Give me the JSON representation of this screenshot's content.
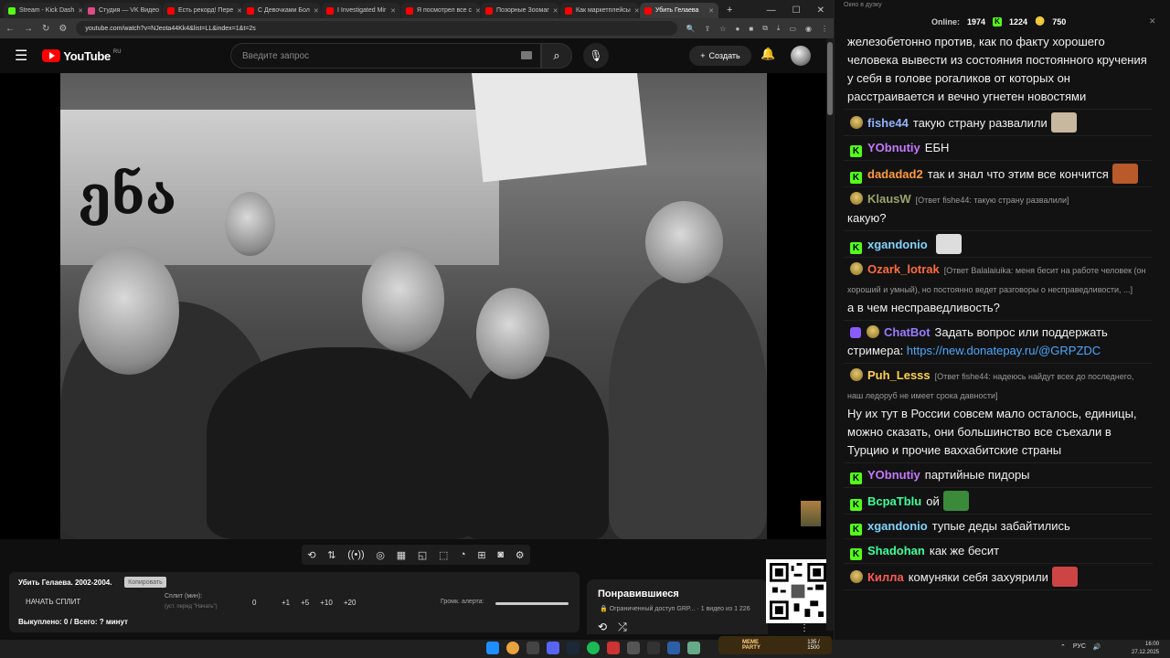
{
  "browser": {
    "tabs": [
      {
        "label": "Stream - Kick Dash",
        "color": "#53fc18",
        "active": false
      },
      {
        "label": "Студия — VK Видео",
        "color": "#e04a8a",
        "active": false
      },
      {
        "label": "Есть рекорд! Пере",
        "color": "#ff0000",
        "active": false
      },
      {
        "label": "С Девочками Бол",
        "color": "#ff0000",
        "active": false
      },
      {
        "label": "I Investigated Mir",
        "color": "#ff0000",
        "active": false
      },
      {
        "label": "Я посмотрел все с",
        "color": "#ff0000",
        "active": false
      },
      {
        "label": "Позорные Зоомаг",
        "color": "#ff0000",
        "active": false
      },
      {
        "label": "Как маркетплейсы",
        "color": "#ff0000",
        "active": false
      },
      {
        "label": "Убить Гелаева",
        "color": "#ff0000",
        "active": true
      }
    ],
    "url": "youtube.com/watch?v=NJeota44Kk4&list=LL&index=1&t=2s",
    "new_tab": "+",
    "window_controls": [
      "—",
      "☐",
      "✕"
    ]
  },
  "youtube": {
    "logo_text": "YouTube",
    "region": "RU",
    "search_placeholder": "Введите запрос",
    "create_label": "Создать"
  },
  "split_panel": {
    "title": "Убить Гелаева. 2002-2004.",
    "copy_label": "Копировать",
    "start_label": "НАЧАТЬ СПЛИТ",
    "split_label": "Сплит (мин):",
    "split_hint": "(уст. перед \"Начать\")",
    "current": "0",
    "increments": [
      "+1",
      "+5",
      "+10",
      "+20"
    ],
    "alert_label": "Громк. алерта:",
    "done_text": "Выкуплено: 0 / Всего: ? минут"
  },
  "liked": {
    "title": "Понравившиеся",
    "subtitle": "Ограниченный доступ GRP...",
    "count": "1 видео из 1 226"
  },
  "chat": {
    "window_title": "Окно в дуэку",
    "online_label": "Online:",
    "online_count": "1974",
    "kick_count": "1224",
    "coin_count": "750",
    "messages": [
      {
        "nick": "",
        "badge": "none",
        "color": "#ffffff",
        "reply": "",
        "text": "железобетонно против, как по факту хорошего человека вывести из состояния постоянного кручения у себя в голове рогаликов от которых он расстраивается и вечно угнетен новостями"
      },
      {
        "nick": "fishe44",
        "badge": "p",
        "color": "#8fb4ff",
        "reply": "",
        "text": "такую страну развалили"
      },
      {
        "nick": "YObnutiy",
        "badge": "k",
        "color": "#c678ff",
        "reply": "",
        "text": "ЕБН"
      },
      {
        "nick": "dadadad2",
        "badge": "k",
        "color": "#ff9a3c",
        "reply": "",
        "text": "так и знал что этим все кончится"
      },
      {
        "nick": "KlausW",
        "badge": "p",
        "color": "#9aa56a",
        "reply": "[Ответ fishe44: такую страну развалили]",
        "text": "какую?"
      },
      {
        "nick": "xgandonio",
        "badge": "k",
        "color": "#7fd4ff",
        "reply": "",
        "text": ""
      },
      {
        "nick": "Ozark_lotrak",
        "badge": "p",
        "color": "#ff6b3d",
        "reply": "[Ответ Balalaiuika: меня бесит на работе человек (он хороший и умный), но постоянно ведет разговоры о несправедливости, ...]",
        "text": "а в чем несправедливость?"
      },
      {
        "nick": "ChatBot",
        "badge": "bot",
        "color": "#9a7bff",
        "reply": "",
        "text": "Задать вопрос или поддержать стримера: ",
        "link": "https://new.donatepay.ru/@GRPZDC"
      },
      {
        "nick": "Puh_Lesss",
        "badge": "p",
        "color": "#ffd24a",
        "reply": "[Ответ fishe44: надеюсь найдут всех до последнего, наш ледоруб не имеет срока давности]",
        "text": "Ну их тут в России совсем мало осталось, единицы, можно сказать, они большинство все съехали в Турцию и прочие ваххабитские страны"
      },
      {
        "nick": "YObnutiy",
        "badge": "k",
        "color": "#c678ff",
        "reply": "",
        "text": "партийные пидоры"
      },
      {
        "nick": "BcpaTblu",
        "badge": "k",
        "color": "#3dff9a",
        "reply": "",
        "text": "ой"
      },
      {
        "nick": "xgandonio",
        "badge": "k",
        "color": "#7fd4ff",
        "reply": "",
        "text": "тупые деды забайтились"
      },
      {
        "nick": "Shadohan",
        "badge": "k",
        "color": "#3dff9a",
        "reply": "",
        "text": "как же бесит"
      },
      {
        "nick": "Килла",
        "badge": "p",
        "color": "#ff5a5a",
        "reply": "",
        "text": "комуняки себя захуярили"
      }
    ]
  },
  "taskbar": {
    "meme_party": "MEME PARTY",
    "meme_progress": "135 / 1500",
    "lang": "РУС",
    "time": "16:00",
    "date": "27.12.2025"
  }
}
